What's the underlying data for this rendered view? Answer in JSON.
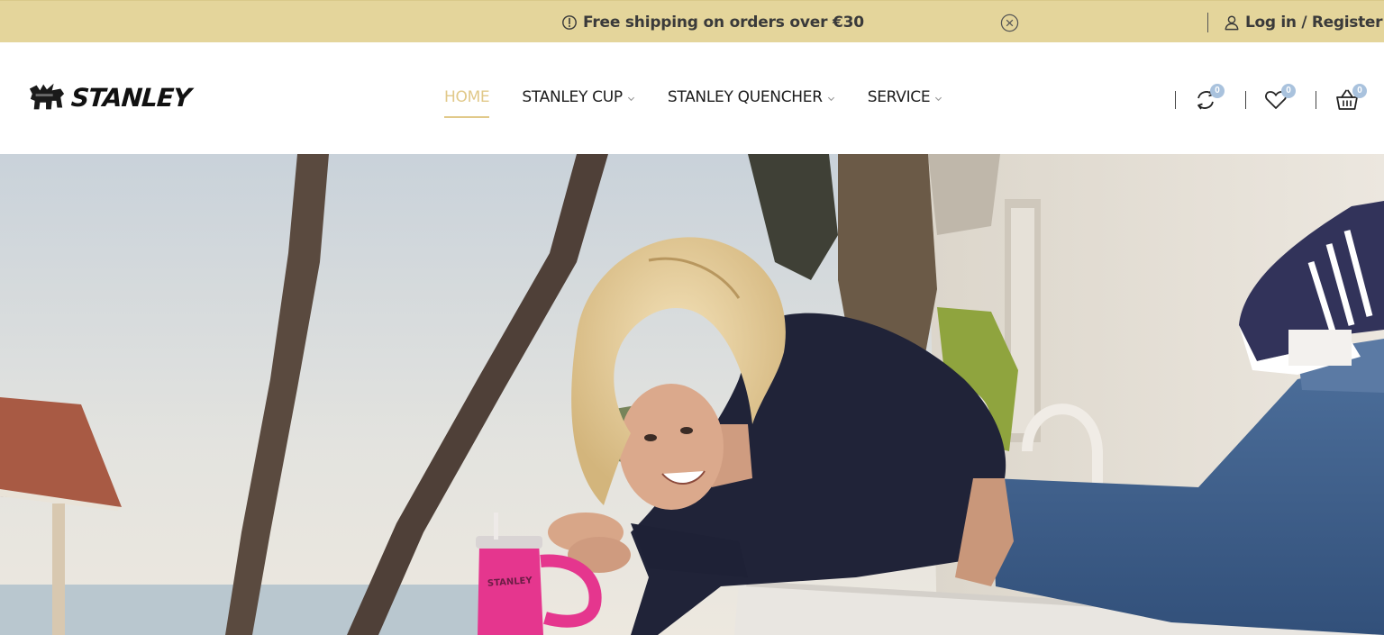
{
  "topbar": {
    "announcement": "Free shipping on orders over €30",
    "login_label": "Log in / Register",
    "background": "#e4d59b"
  },
  "brand": {
    "name": "STANLEY"
  },
  "nav": {
    "items": [
      {
        "label": "HOME",
        "active": true,
        "has_dropdown": false
      },
      {
        "label": "STANLEY CUP",
        "active": false,
        "has_dropdown": true
      },
      {
        "label": "STANLEY QUENCHER",
        "active": false,
        "has_dropdown": true
      },
      {
        "label": "SERVICE",
        "active": false,
        "has_dropdown": true
      }
    ],
    "active_color": "#e1c98a"
  },
  "header_icons": {
    "compare_count": "0",
    "wishlist_count": "0",
    "cart_count": "0",
    "badge_color": "#a9c2dd"
  },
  "hero": {
    "cup_brand": "STANLEY",
    "cup_color": "#e5368e"
  }
}
